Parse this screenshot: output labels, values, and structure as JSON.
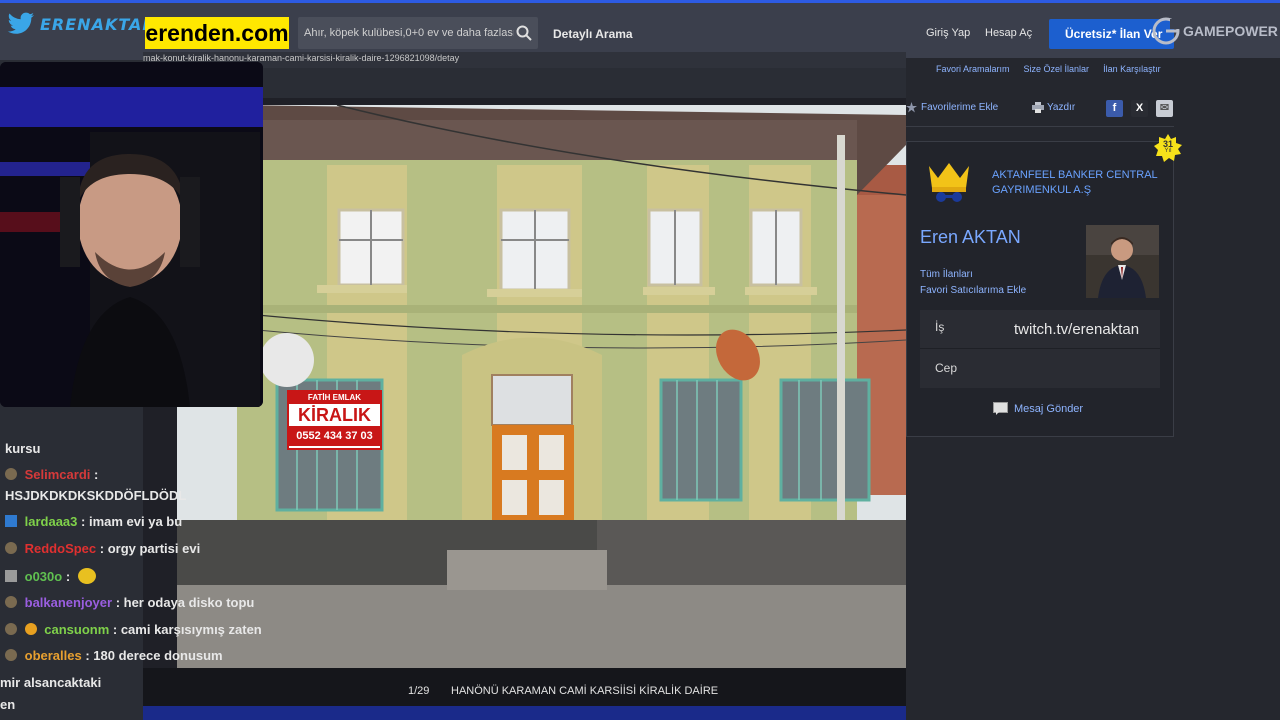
{
  "header": {
    "streamer_logo_text": "ERENAKTAN",
    "brand": "erenden.com",
    "search_placeholder": "Ahır, köpek kulübesi,0+0 ev ve daha fazlası",
    "advanced_search": "Detaylı Arama",
    "login": "Giriş Yap",
    "register": "Hesap Aç",
    "cta": "Ücretsiz* İlan Ver",
    "sponsor": "GAMEPOWER"
  },
  "url_fragment": "mak-konut-kiralik-hanonu-karaman-cami-karsisi-kiralik-daire-1296821098/detay",
  "listing": {
    "photo_counter": "1/29",
    "title": "HANÖNÜ KARAMAN CAMİ KARSİİSİ KİRALİK DAİRE",
    "sign_top": "FATİH EMLAK",
    "sign_main": "KİRALIK",
    "sign_phone": "0552 434 37 03"
  },
  "right_panel": {
    "links": [
      "Favori Aramalarım",
      "Size Özel İlanlar",
      "İlan Karşılaştır"
    ],
    "add_favorite": "Favorilerime Ekle",
    "print": "Yazdır",
    "badge_years": "31",
    "badge_unit": "Yıl",
    "agency": "AKTANFEEL BANKER CENTRAL GAYRIMENKUL A.Ş",
    "agent_name": "Eren AKTAN",
    "all_listings": "Tüm İlanları",
    "fav_seller": "Favori Satıcılarıma Ekle",
    "phone_work_label": "İş",
    "phone_work_value": "twitch.tv/erenaktan",
    "phone_mobile_label": "Cep",
    "send_message": "Mesaj Gönder",
    "share_x": "X"
  },
  "chat": [
    {
      "user": "",
      "text": "kursu",
      "color": "#f2f2f2"
    },
    {
      "user": "Selimcardi",
      "text": ":",
      "color": "#d63a3a"
    },
    {
      "user": "",
      "text": "HSJDKDKDKSKDDÖFLDÖDL",
      "color": "#f2f2f2"
    },
    {
      "user": "lardaaa3",
      "text": ": imam evi ya bu",
      "color": "#7fd14a"
    },
    {
      "user": "ReddoSpec",
      "text": ": orgy partisi evi",
      "color": "#e03030"
    },
    {
      "user": "o030o",
      "text": ":",
      "color": "#60c050"
    },
    {
      "user": "balkanenjoyer",
      "text": ": her odaya disko topu",
      "color": "#9a5ee0"
    },
    {
      "user": "cansuonm",
      "text": ": cami karşısıymış zaten",
      "color": "#7fd14a"
    },
    {
      "user": "oberalles",
      "text": ": 180 derece donusum",
      "color": "#e8a030"
    },
    {
      "user": "",
      "text": "mir alsancaktaki",
      "color": "#f2f2f2"
    },
    {
      "user": "",
      "text": "en",
      "color": "#f2f2f2"
    }
  ],
  "colors": {
    "brand_yellow": "#ffe800",
    "link_blue": "#8eb4ff",
    "cta_blue": "#1c5fcf",
    "topbar": "#3b3f4c"
  }
}
